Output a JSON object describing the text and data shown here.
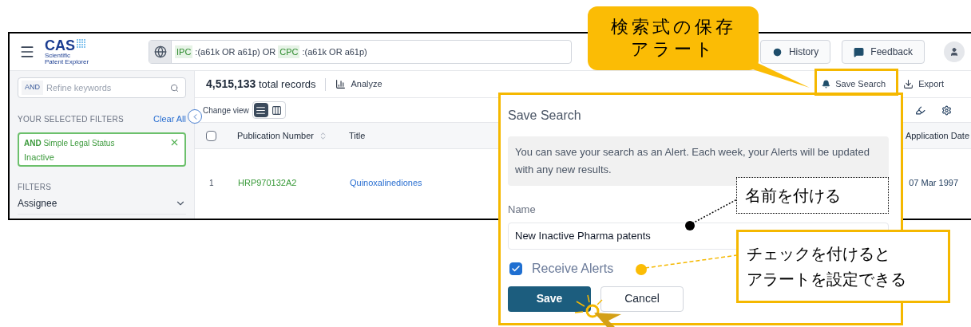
{
  "header": {
    "logo": {
      "name": "CAS",
      "subtitle_lines": [
        "Scientific",
        "Patent Explorer"
      ]
    },
    "query": [
      {
        "kind": "field",
        "text": "IPC"
      },
      {
        "kind": "text",
        "text": ":(a61k OR a61p) OR"
      },
      {
        "kind": "field",
        "text": "CPC"
      },
      {
        "kind": "text",
        "text": ":(a61k OR a61p)"
      }
    ],
    "buttons": [
      {
        "kind": "history",
        "label": "History"
      },
      {
        "kind": "feedback",
        "label": "Feedback"
      }
    ]
  },
  "sidebar": {
    "refine": {
      "operator": "AND",
      "placeholder": "Refine keywords"
    },
    "selected_heading": "YOUR SELECTED FILTERS",
    "clear": "Clear All",
    "chips": [
      {
        "operator": "AND",
        "label": "Simple Legal Status",
        "value": "Inactive"
      }
    ],
    "filters_heading": "FILTERS",
    "filters": [
      {
        "label": "Assignee",
        "expanded": false
      }
    ]
  },
  "results": {
    "count": "4,515,133",
    "count_label": "total records",
    "analyze": "Analyze",
    "save_search": "Save Search",
    "export": "Export",
    "change_view": "Change view",
    "views": [
      {
        "kind": "list",
        "selected": true
      },
      {
        "kind": "cards",
        "selected": false
      }
    ],
    "select_all": {
      "checked": false
    },
    "columns": [
      {
        "label": "Publication Number",
        "sortable": true
      },
      {
        "label": "Title",
        "sortable": false
      },
      {
        "label": "Application Date",
        "sortable": false
      }
    ],
    "rows": [
      {
        "index": "1",
        "number": "HRP970132A2",
        "title": "Quinoxalinediones",
        "date": "07 Mar 1997"
      }
    ]
  },
  "dialog": {
    "title": "Save Search",
    "message": "You can save your search as an Alert. Each week, your Alerts will be updated with any new results.",
    "name_label": "Name",
    "name_value": "New Inactive Pharma patents",
    "receive_alerts": {
      "label": "Receive Alerts",
      "checked": true
    },
    "save": "Save",
    "cancel": "Cancel"
  },
  "annotations": [
    {
      "kind": "bubble",
      "lines": [
        "検索式の保存",
        "アラート"
      ]
    },
    {
      "kind": "dotted_note",
      "lines": [
        "名前を付ける"
      ]
    },
    {
      "kind": "boxed_note",
      "lines": [
        "チェックを付けると",
        "アラートを設定できる"
      ]
    }
  ]
}
